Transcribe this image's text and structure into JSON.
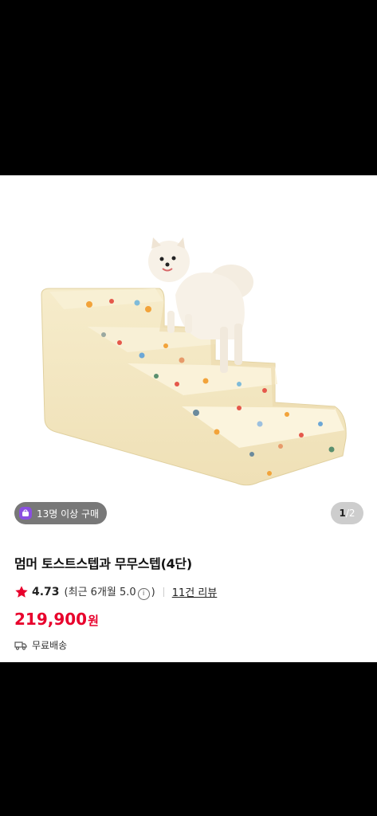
{
  "product": {
    "image_alt": "pomeranian dog standing on a cream 4-step pet stair",
    "purchase_badge": "13명 이상 구매",
    "image_counter": {
      "current": "1",
      "separator": "/",
      "total": "2"
    },
    "title": "멈머 토스트스텝과 무무스텝(4단)",
    "rating": "4.73",
    "recent_rating_prefix": "(최근 6개월 5.0",
    "recent_rating_suffix": ")",
    "review_count": "11건 리뷰",
    "price": "219,900",
    "currency": "원",
    "shipping": "무료배송"
  },
  "colors": {
    "price": "#e8002c",
    "star": "#e8002c",
    "badge_icon": "#8a4fe0"
  }
}
